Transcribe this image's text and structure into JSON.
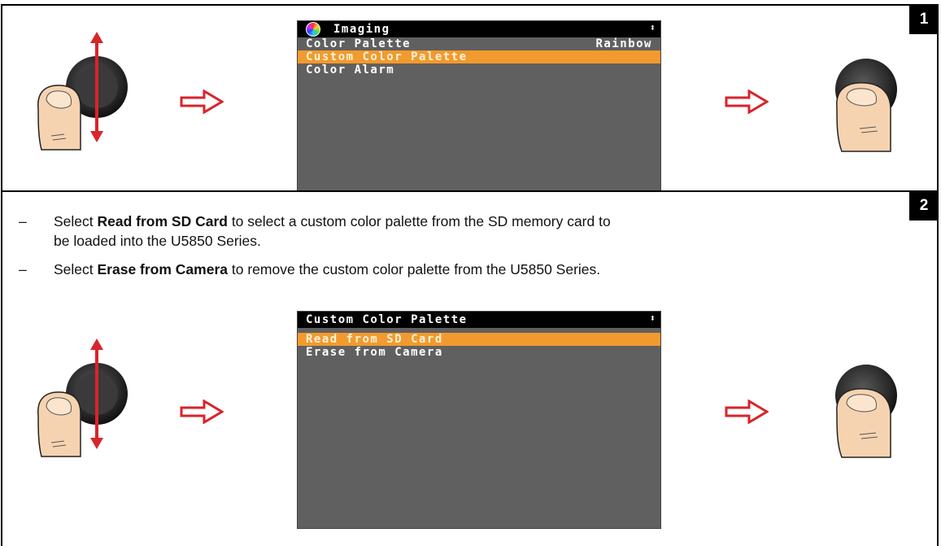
{
  "step1": {
    "number": "1",
    "screen": {
      "title": "Imaging",
      "scroll_glyph": "⬍",
      "rows": [
        {
          "label": "Color Palette",
          "value": "Rainbow",
          "selected": false
        },
        {
          "label": "Custom Color Palette",
          "value": "",
          "selected": true
        },
        {
          "label": "Color Alarm",
          "value": "",
          "selected": false
        }
      ]
    }
  },
  "step2": {
    "number": "2",
    "bullets": [
      {
        "dash": "–",
        "pre": "Select ",
        "bold": "Read from SD Card",
        "post": " to select a custom color palette from the SD memory card to",
        "line2": "be loaded into the U5850 Series."
      },
      {
        "dash": "–",
        "pre": "Select ",
        "bold": "Erase from Camera",
        "post": " to remove the custom color palette from the U5850 Series.",
        "line2": ""
      }
    ],
    "screen": {
      "title": "Custom Color Palette",
      "scroll_glyph": "⬍",
      "rows": [
        {
          "label": "Read from SD Card",
          "value": "",
          "selected": true
        },
        {
          "label": "Erase from Camera",
          "value": "",
          "selected": false
        }
      ]
    }
  },
  "colors": {
    "highlight": "#f29a2e",
    "screen_bg": "#606060",
    "arrow_red": "#d8242b",
    "skin": "#f6d3b0"
  },
  "icons": [
    "joystick-scroll-icon",
    "right-arrow-icon",
    "joystick-press-icon",
    "color-wheel-icon"
  ]
}
